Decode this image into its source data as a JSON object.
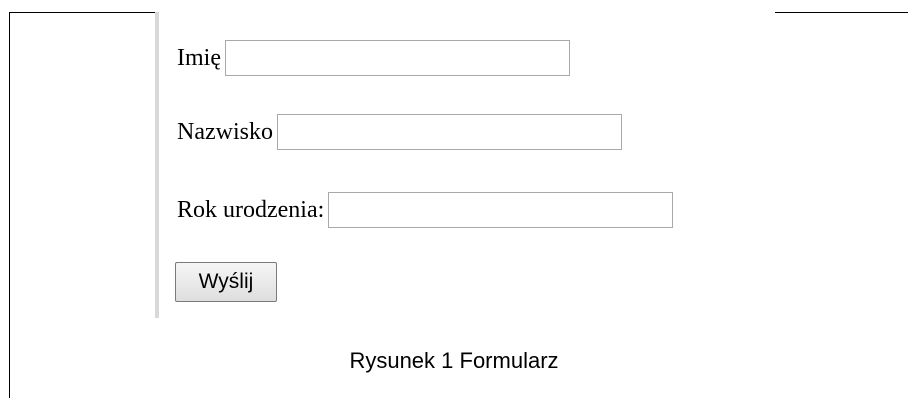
{
  "form": {
    "first_name_label": "Imię",
    "first_name_value": "",
    "last_name_label": "Nazwisko",
    "last_name_value": "",
    "birth_year_label": "Rok urodzenia:",
    "birth_year_value": "",
    "submit_label": "Wyślij"
  },
  "caption": "Rysunek 1 Formularz"
}
